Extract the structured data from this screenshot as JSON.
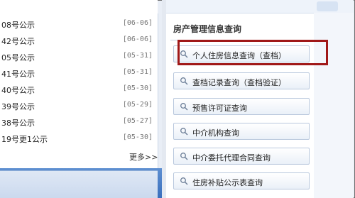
{
  "news": {
    "items": [
      {
        "title": "08号公示",
        "date": "[06-06]"
      },
      {
        "title": "42号公示",
        "date": "[06-06]"
      },
      {
        "title": "05号公示",
        "date": "[05-31]"
      },
      {
        "title": "41号公示",
        "date": "[05-31]"
      },
      {
        "title": "40号公示",
        "date": "[05-30]"
      },
      {
        "title": "39号公示",
        "date": "[05-29]"
      },
      {
        "title": "38号公示",
        "date": "[05-27]"
      },
      {
        "title": "19号更1公示",
        "date": "[05-30]"
      }
    ],
    "more_label": "更多>>"
  },
  "query_panel": {
    "title": "房产管理信息查询",
    "items": [
      {
        "label": "个人住房信息查询（查档）",
        "icon": "search-icon"
      },
      {
        "label": "查档记录查询（查档验证）",
        "icon": "search-icon"
      },
      {
        "label": "预售许可证查询",
        "icon": "search-icon"
      },
      {
        "label": "中介机构查询",
        "icon": "search-icon"
      },
      {
        "label": "中介委托代理合同查询",
        "icon": "search-icon"
      },
      {
        "label": "住房补贴公示表查询",
        "icon": "search-icon"
      }
    ]
  },
  "colors": {
    "highlight": "#a01818",
    "accent_blue": "#3a6fbd"
  }
}
